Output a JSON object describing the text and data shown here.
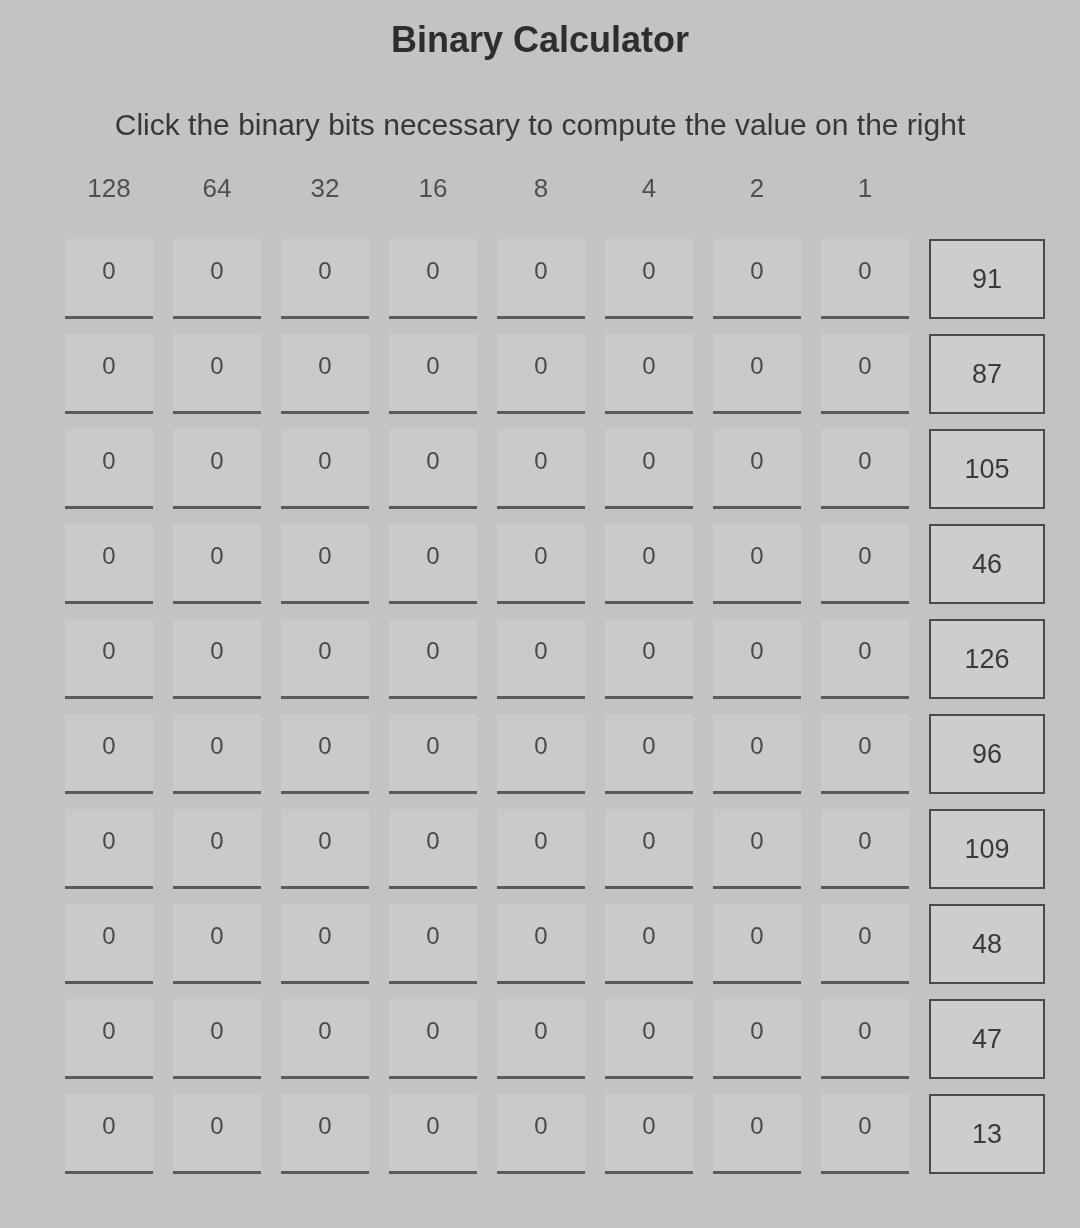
{
  "title": "Binary Calculator",
  "instruction": "Click the binary bits necessary to compute the value on the right",
  "bit_headers": [
    "128",
    "64",
    "32",
    "16",
    "8",
    "4",
    "2",
    "1"
  ],
  "rows": [
    {
      "bits": [
        "0",
        "0",
        "0",
        "0",
        "0",
        "0",
        "0",
        "0"
      ],
      "target": "91"
    },
    {
      "bits": [
        "0",
        "0",
        "0",
        "0",
        "0",
        "0",
        "0",
        "0"
      ],
      "target": "87"
    },
    {
      "bits": [
        "0",
        "0",
        "0",
        "0",
        "0",
        "0",
        "0",
        "0"
      ],
      "target": "105"
    },
    {
      "bits": [
        "0",
        "0",
        "0",
        "0",
        "0",
        "0",
        "0",
        "0"
      ],
      "target": "46"
    },
    {
      "bits": [
        "0",
        "0",
        "0",
        "0",
        "0",
        "0",
        "0",
        "0"
      ],
      "target": "126"
    },
    {
      "bits": [
        "0",
        "0",
        "0",
        "0",
        "0",
        "0",
        "0",
        "0"
      ],
      "target": "96"
    },
    {
      "bits": [
        "0",
        "0",
        "0",
        "0",
        "0",
        "0",
        "0",
        "0"
      ],
      "target": "109"
    },
    {
      "bits": [
        "0",
        "0",
        "0",
        "0",
        "0",
        "0",
        "0",
        "0"
      ],
      "target": "48"
    },
    {
      "bits": [
        "0",
        "0",
        "0",
        "0",
        "0",
        "0",
        "0",
        "0"
      ],
      "target": "47"
    },
    {
      "bits": [
        "0",
        "0",
        "0",
        "0",
        "0",
        "0",
        "0",
        "0"
      ],
      "target": "13"
    }
  ]
}
